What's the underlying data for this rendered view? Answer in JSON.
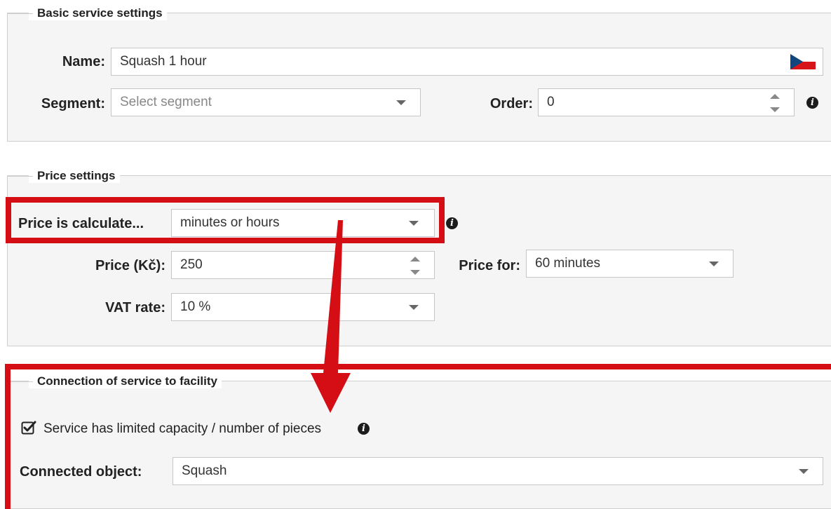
{
  "basic": {
    "legend": "Basic service settings",
    "name_label": "Name:",
    "name_value": "Squash 1 hour",
    "segment_label": "Segment:",
    "segment_placeholder": "Select segment",
    "order_label": "Order:",
    "order_value": "0"
  },
  "price": {
    "legend": "Price settings",
    "calc_label": "Price is calculate...",
    "calc_value": "minutes or hours",
    "price_label": "Price (Kč):",
    "price_value": "250",
    "price_for_label": "Price for:",
    "price_for_value": "60 minutes",
    "vat_label": "VAT rate:",
    "vat_value": "10 %"
  },
  "connection": {
    "legend": "Connection of service to facility",
    "limited_label": "Service has limited capacity / number of pieces",
    "limited_checked": true,
    "object_label": "Connected object:",
    "object_value": "Squash"
  },
  "colors": {
    "highlight": "#d40e14",
    "panel": "#f5f5f5",
    "border": "#cfcfcf"
  },
  "icons": [
    "czech-flag-icon",
    "info-icon",
    "dropdown-arrow-icon",
    "spinner-icon",
    "checkbox-icon"
  ]
}
